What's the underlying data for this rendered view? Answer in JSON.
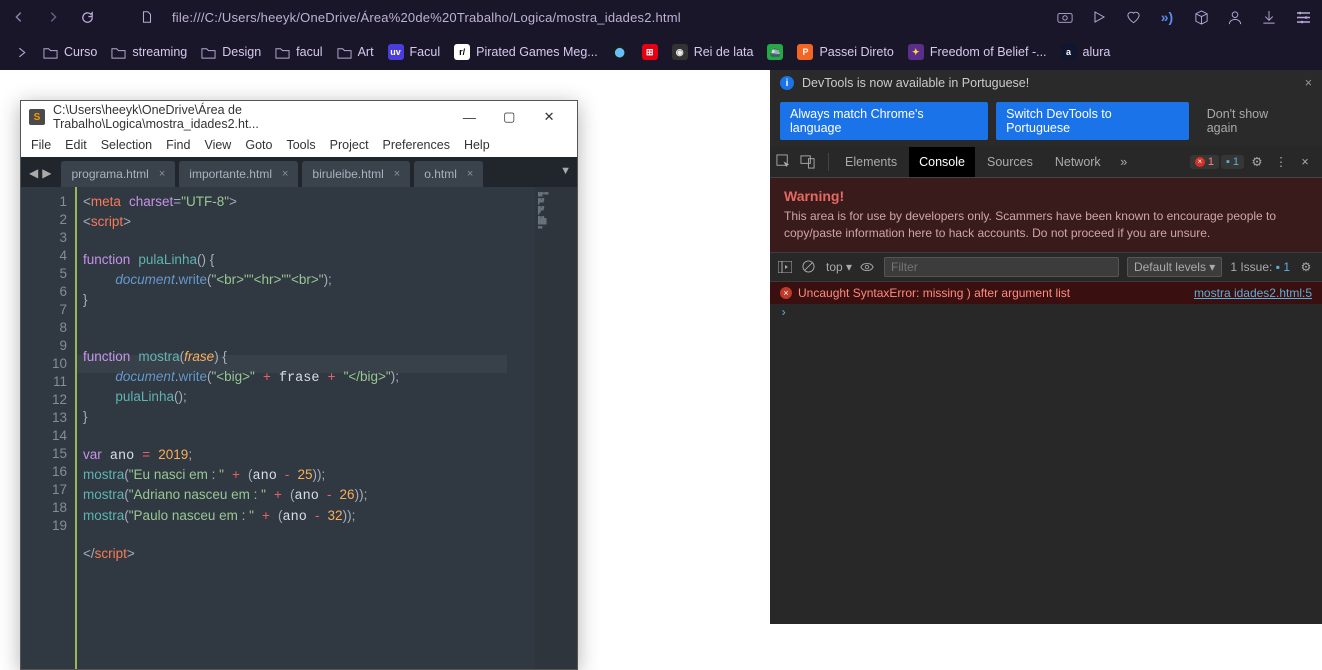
{
  "browser": {
    "url": "file:///C:/Users/heeyk/OneDrive/Área%20de%20Trabalho/Logica/mostra_idades2.html",
    "bookmarks": [
      "Curso",
      "streaming",
      "Design",
      "facul",
      "Art",
      "Facul",
      "Pirated Games Meg...",
      "Rei de lata",
      "Passei Direto",
      "Freedom of Belief -...",
      "alura"
    ]
  },
  "sublime": {
    "title": "C:\\Users\\heeyk\\OneDrive\\Área de Trabalho\\Logica\\mostra_idades2.ht...",
    "menu": [
      "File",
      "Edit",
      "Selection",
      "Find",
      "View",
      "Goto",
      "Tools",
      "Project",
      "Preferences",
      "Help"
    ],
    "tabs": [
      "programa.html",
      "importante.html",
      "biruleibe.html",
      "o.html"
    ],
    "lines": [
      "1",
      "2",
      "3",
      "4",
      "5",
      "6",
      "7",
      "8",
      "9",
      "10",
      "11",
      "12",
      "13",
      "14",
      "15",
      "16",
      "17",
      "18",
      "19"
    ]
  },
  "devtools": {
    "info": "DevTools is now available in Portuguese!",
    "btn1": "Always match Chrome's language",
    "btn2": "Switch DevTools to Portuguese",
    "btn3": "Don't show again",
    "tabs": [
      "Elements",
      "Console",
      "Sources",
      "Network"
    ],
    "err_count": "1",
    "iss_count": "1",
    "warn_title": "Warning!",
    "warn_body": "This area is for use by developers only. Scammers have been known to encourage people to copy/paste information here to hack accounts. Do not proceed if you are unsure.",
    "top": "top ▾",
    "filter_ph": "Filter",
    "levels": "Default levels ▾",
    "issue_lbl": "1 Issue:",
    "issue_n": "1",
    "error_msg": "Uncaught SyntaxError: missing ) after argument list",
    "error_src": "mostra idades2.html:5"
  }
}
